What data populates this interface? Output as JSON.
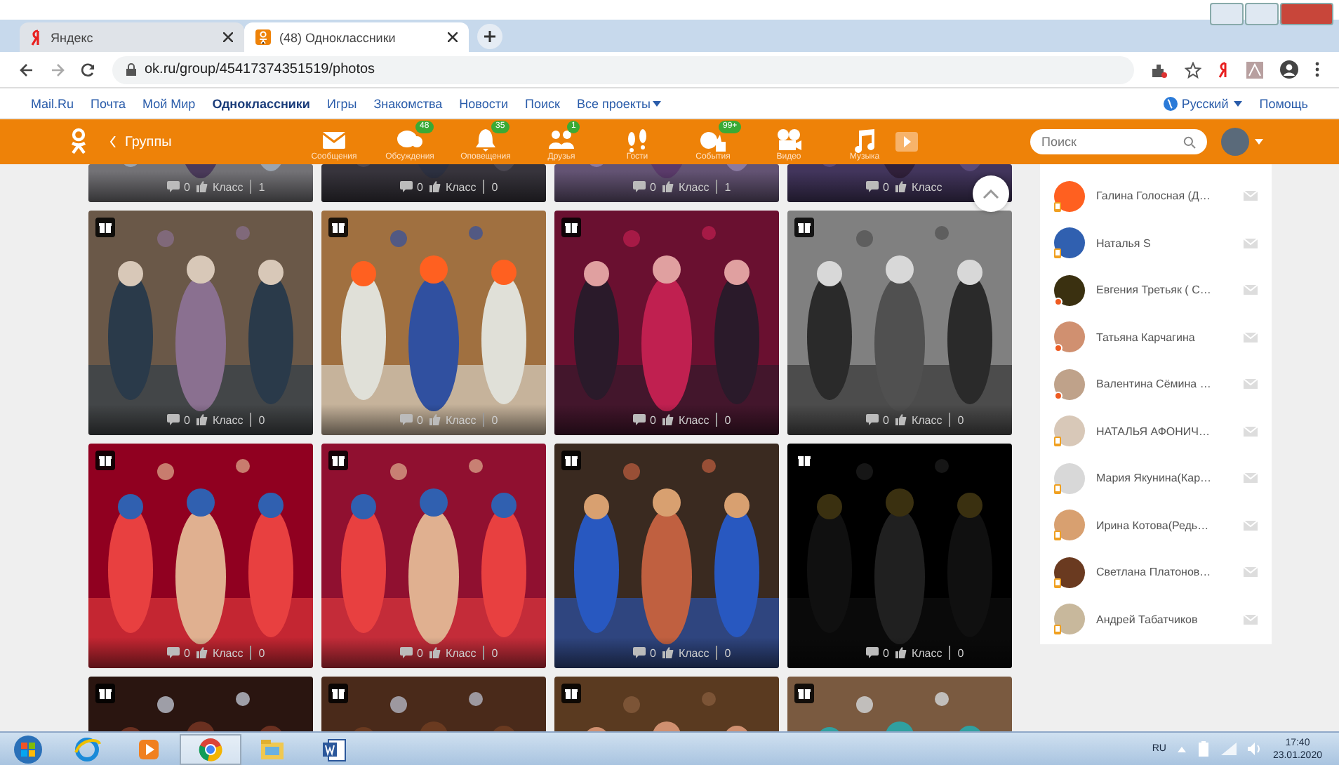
{
  "browser": {
    "tabs": [
      {
        "title": "Яндекс",
        "selected": false,
        "kind": "yandex"
      },
      {
        "title": "(48) Одноклассники",
        "selected": true,
        "kind": "ok"
      }
    ],
    "address": "ok.ru/group/45417374351519/photos"
  },
  "portal_bar": {
    "links": [
      {
        "label": "Mail.Ru",
        "selected": false
      },
      {
        "label": "Почта",
        "selected": false
      },
      {
        "label": "Мой Мир",
        "selected": false
      },
      {
        "label": "Одноклассники",
        "selected": true
      },
      {
        "label": "Игры",
        "selected": false
      },
      {
        "label": "Знакомства",
        "selected": false
      },
      {
        "label": "Новости",
        "selected": false
      },
      {
        "label": "Поиск",
        "selected": false
      },
      {
        "label": "Все проекты",
        "selected": false
      }
    ],
    "language": "Русский",
    "help": "Помощь"
  },
  "header": {
    "back": "Группы",
    "nav": [
      {
        "kind": "messages",
        "label": "Сообщения"
      },
      {
        "kind": "discussions",
        "label": "Обсуждения",
        "badge": "48"
      },
      {
        "kind": "notifications",
        "label": "Оповещения",
        "badge": "35"
      },
      {
        "kind": "friends",
        "label": "Друзья",
        "badge": "1"
      },
      {
        "kind": "guests",
        "label": "Гости"
      },
      {
        "kind": "events",
        "label": "События",
        "badge": "99+"
      },
      {
        "kind": "video",
        "label": "Видео"
      },
      {
        "kind": "music",
        "label": "Музыка"
      }
    ],
    "search": {
      "placeholder": "Поиск"
    }
  },
  "photos": [
    {
      "kind": "bottom",
      "comments": "0",
      "like": "Класс",
      "likes": "1"
    },
    {
      "kind": "bottom",
      "comments": "0",
      "like": "Класс",
      "likes": "0"
    },
    {
      "kind": "bottom",
      "comments": "0",
      "like": "Класс",
      "likes": "1"
    },
    {
      "kind": "bottom",
      "comments": "0",
      "like": "Класс"
    },
    {
      "kind": "full",
      "comments": "0",
      "like": "Класс",
      "likes": "0"
    },
    {
      "kind": "full",
      "comments": "0",
      "like": "Класс",
      "likes": "0"
    },
    {
      "kind": "full",
      "comments": "0",
      "like": "Класс",
      "likes": "0"
    },
    {
      "kind": "full",
      "comments": "0",
      "like": "Класс",
      "likes": "0"
    },
    {
      "kind": "full",
      "comments": "0",
      "like": "Класс",
      "likes": "0"
    },
    {
      "kind": "full",
      "comments": "0",
      "like": "Класс",
      "likes": "0"
    },
    {
      "kind": "full",
      "comments": "0",
      "like": "Класс",
      "likes": "0"
    },
    {
      "kind": "full",
      "comments": "0",
      "like": "Класс",
      "likes": "0"
    },
    {
      "kind": "top"
    },
    {
      "kind": "top"
    },
    {
      "kind": "top"
    },
    {
      "kind": "top"
    }
  ],
  "friends": [
    {
      "name": "Галина Голосная (Д…",
      "kind": "mobile"
    },
    {
      "name": "Наталья S",
      "kind": "mobile"
    },
    {
      "name": "Евгения Третьяк ( С…",
      "kind": "online"
    },
    {
      "name": "Татьяна Карчагина",
      "kind": "online"
    },
    {
      "name": "Валентина Сёмина …",
      "kind": "online"
    },
    {
      "name": "НАТАЛЬЯ АФОНИЧ…",
      "kind": "mobile"
    },
    {
      "name": "Мария Якунина(Кар…",
      "kind": "mobile"
    },
    {
      "name": "Ирина Котова(Редь…",
      "kind": "mobile"
    },
    {
      "name": "Светлана Платонов…",
      "kind": "mobile"
    },
    {
      "name": "Андрей Табатчиков",
      "kind": "mobile"
    }
  ],
  "taskbar": {
    "apps": [
      {
        "kind": "ie",
        "selected": false
      },
      {
        "kind": "media",
        "selected": false
      },
      {
        "kind": "chrome",
        "selected": true
      },
      {
        "kind": "explorer",
        "selected": false
      },
      {
        "kind": "word",
        "selected": false
      }
    ],
    "language": "RU",
    "time": "17:40",
    "date": "23.01.2020"
  }
}
